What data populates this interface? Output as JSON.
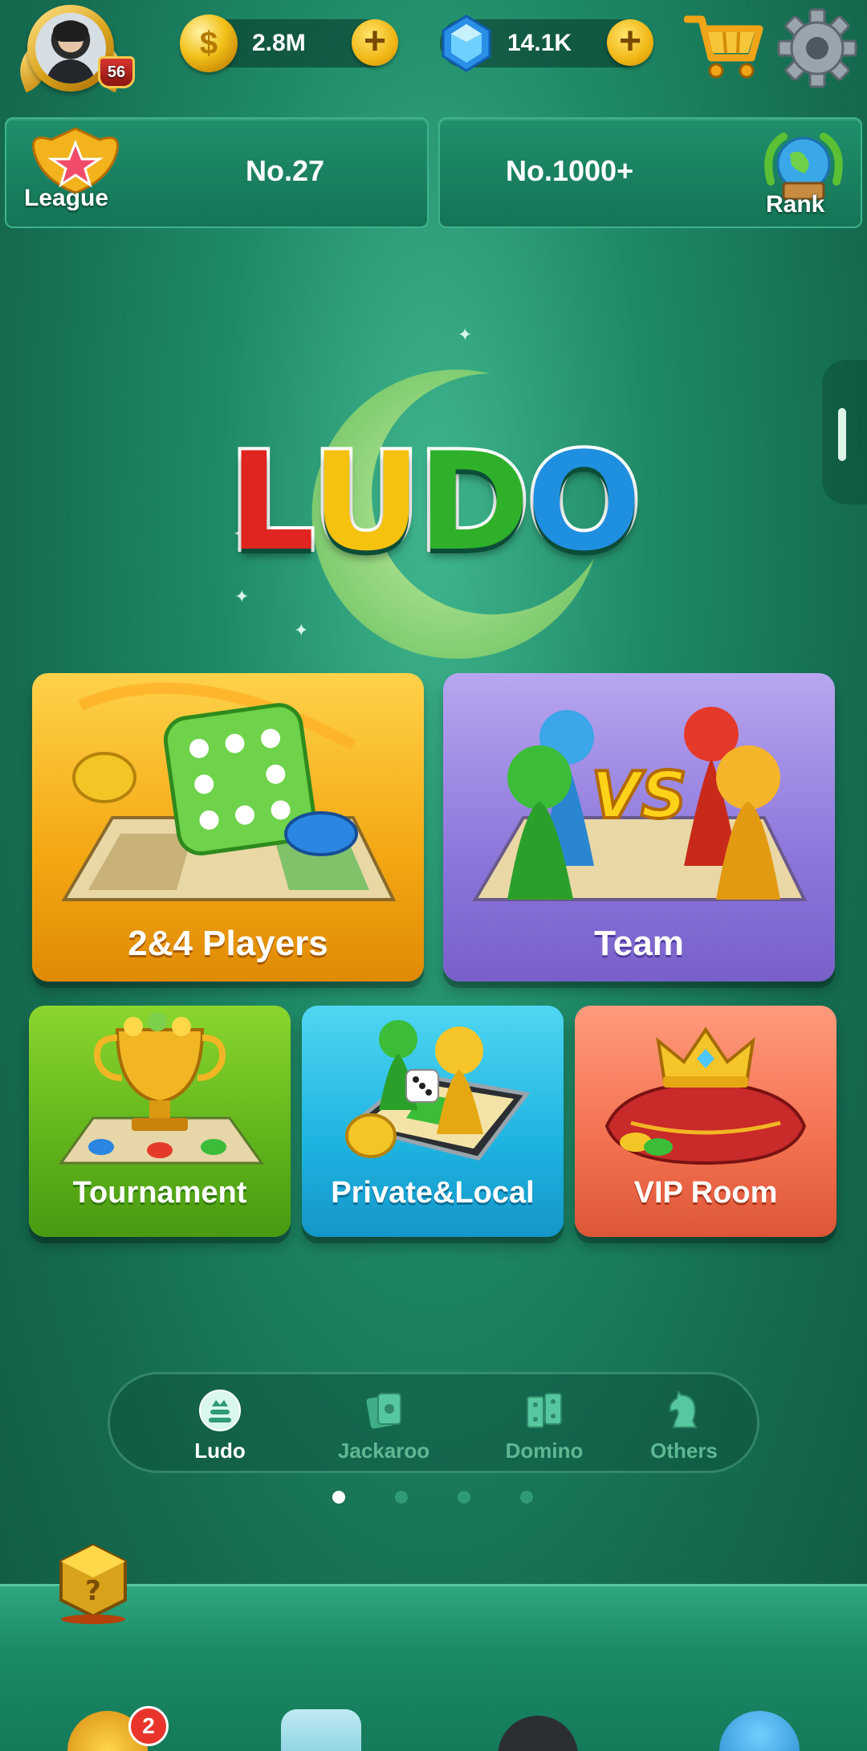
{
  "profile": {
    "level": "56"
  },
  "currency": {
    "coins": "2.8M",
    "gems": "14.1K",
    "plus": "+"
  },
  "rank_strip": {
    "league_label": "League",
    "league_rank": "No.27",
    "world_rank": "No.1000+",
    "rank_label": "Rank"
  },
  "logo": {
    "letters": [
      "L",
      "U",
      "D",
      "O"
    ],
    "colors": [
      "#e0241f",
      "#f5c20f",
      "#2fb02a",
      "#1f8fe0"
    ]
  },
  "modes": {
    "players": "2&4 Players",
    "team": "Team",
    "tournament": "Tournament",
    "private": "Private&Local",
    "vip": "VIP Room"
  },
  "categories": [
    {
      "label": "Ludo",
      "active": true
    },
    {
      "label": "Jackaroo",
      "active": false
    },
    {
      "label": "Domino",
      "active": false
    },
    {
      "label": "Others",
      "active": false
    }
  ],
  "pagination": {
    "pages": 4,
    "current": 1
  },
  "bottom_nav": {
    "notification_count": "2"
  },
  "colors": {
    "accent_gold": "#f2c21a",
    "background_green": "#1f8a67"
  }
}
